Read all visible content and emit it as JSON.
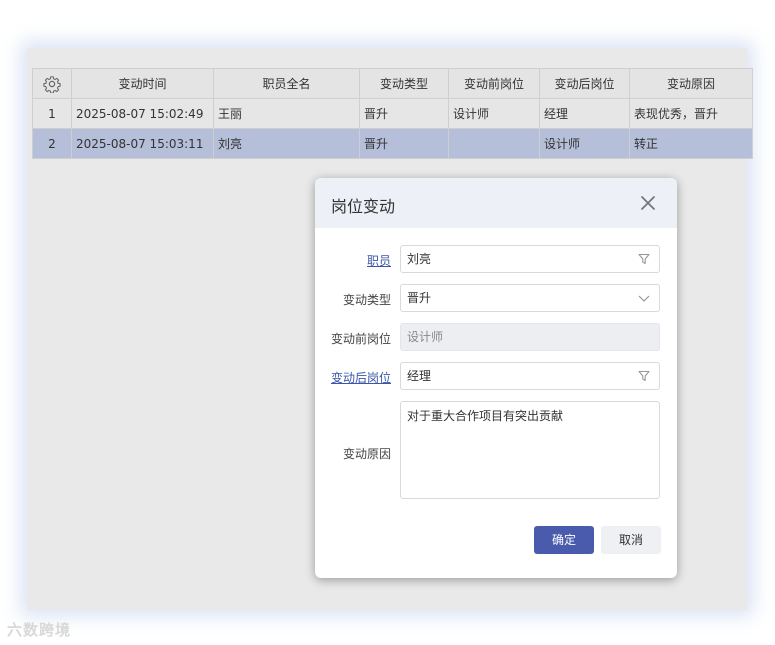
{
  "table": {
    "headers": [
      "变动时间",
      "职员全名",
      "变动类型",
      "变动前岗位",
      "变动后岗位",
      "变动原因"
    ],
    "rows": [
      {
        "no": "1",
        "time": "2025-08-07 15:02:49",
        "name": "王丽",
        "type": "晋升",
        "before": "设计师",
        "after": "经理",
        "reason": "表现优秀，晋升"
      },
      {
        "no": "2",
        "time": "2025-08-07 15:03:11",
        "name": "刘亮",
        "type": "晋升",
        "before": "",
        "after": "设计师",
        "reason": "转正"
      }
    ],
    "selected_row": 2
  },
  "dialog": {
    "title": "岗位变动",
    "employee_label": "职员",
    "employee_value": "刘亮",
    "type_label": "变动类型",
    "type_value": "晋升",
    "before_label": "变动前岗位",
    "before_placeholder": "设计师",
    "after_label": "变动后岗位",
    "after_value": "经理",
    "reason_label": "变动原因",
    "reason_value": "对于重大合作项目有突出贡献",
    "ok_label": "确定",
    "cancel_label": "取消"
  },
  "watermark": "六数跨境",
  "colors": {
    "selected_row": "#b5bfd9",
    "primary_button": "#4a5bae",
    "link": "#3b56a8"
  }
}
